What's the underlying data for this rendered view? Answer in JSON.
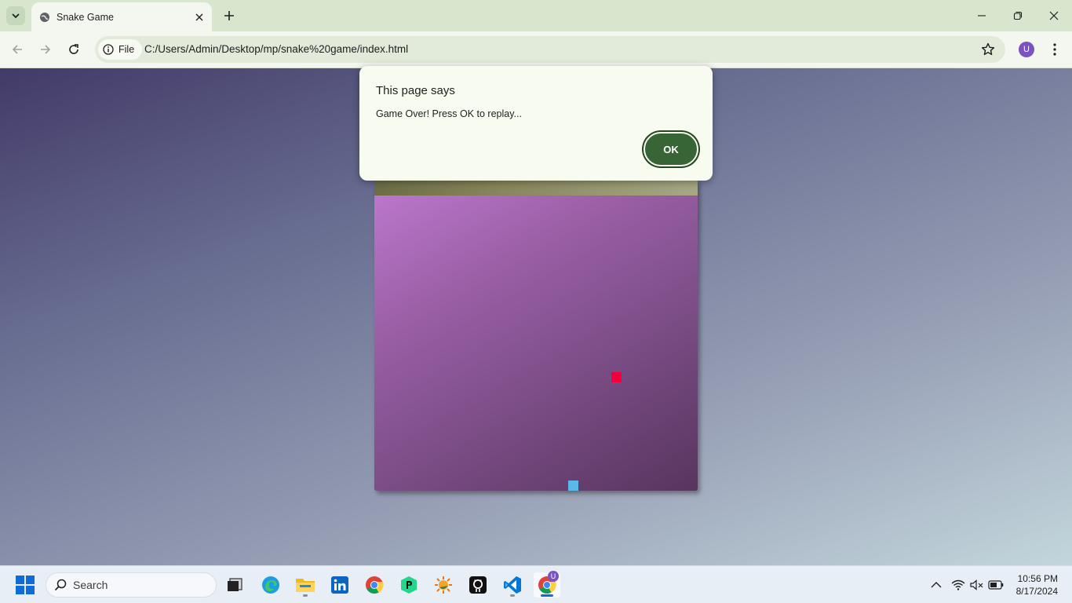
{
  "browser": {
    "tab_title": "Snake Game",
    "address_chip_label": "File",
    "url": "C:/Users/Admin/Desktop/mp/snake%20game/index.html",
    "profile_initial": "U",
    "accent": "#386535"
  },
  "dialog": {
    "title": "This page says",
    "message": "Game Over! Press OK to replay...",
    "ok_label": "OK"
  },
  "game": {
    "food_color": "#f2003e",
    "snake_color": "#5ab9ea"
  },
  "taskbar": {
    "search_placeholder": "Search",
    "apps": [
      "task-view",
      "edge",
      "file-explorer",
      "linkedin",
      "chrome",
      "pycharm-edu",
      "weather",
      "github",
      "vscode",
      "chrome-active"
    ],
    "chrome_badge": "U",
    "time": "10:56 PM",
    "date": "8/17/2024"
  }
}
